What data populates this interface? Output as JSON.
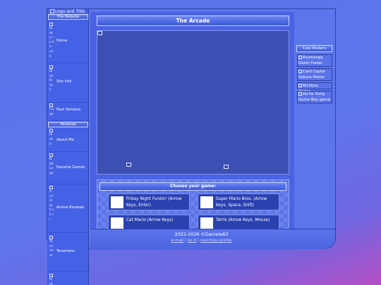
{
  "logo_alt": "Logo and Title",
  "sidebar": {
    "the_website": {
      "heading": "The Website",
      "items": [
        {
          "glyph": "Ki rb y rs ho us e",
          "label": "Home"
        },
        {
          "glyph": "Bl ue Ki rb y",
          "label": "Site Info"
        },
        {
          "glyph": "Ca ge",
          "label": "Past Versions"
        }
      ]
    },
    "personal": {
      "heading": "Personal",
      "items": [
        {
          "glyph": "Ki rb y",
          "label": "About Me"
        },
        {
          "glyph": "N 64 Lo go",
          "label": "Favorite Games"
        },
        {
          "glyph": "A cri st al 5 ch ri",
          "label": "Anime Reviews"
        },
        {
          "glyph": "Te mi ne ss",
          "label": "Tenarisms"
        },
        {
          "glyph": "Ki rb y",
          "label": ""
        }
      ]
    }
  },
  "main": {
    "title": "The Arcade",
    "choose": {
      "heading": "Choose your game:",
      "games": [
        {
          "title": "Friday Night Funkin' (Arrow Keys, Enter)"
        },
        {
          "title": "Super Mario Bros. (Arrow Keys, Space, Shift)"
        },
        {
          "title": "Cat Mario (Arrow Keys)"
        },
        {
          "title": "Tetris (Arrow Keys, Mouse)"
        }
      ]
    }
  },
  "cool_posters": {
    "heading": "Cool Posters",
    "items": [
      {
        "label": "Azumanga Daioh Poster"
      },
      {
        "label": "Card Captor Sakura Poster"
      },
      {
        "label": "Nichijou Poster"
      },
      {
        "label": "Ad for Kirby Game Boy game"
      }
    ]
  },
  "footer": {
    "copyright": "2022-2026 ©Daniele63",
    "links": [
      "e-mail",
      "ko-fi",
      "neocities profile"
    ],
    "separator": "|"
  },
  "icons": [
    "broken-image-icon"
  ],
  "colors": {
    "page_bg": "#5a73ea",
    "panel": "#4561e6",
    "game_area": "#3d4fb3",
    "card": "#2a42b0",
    "accent_bottom_right": "#b44fc4"
  }
}
